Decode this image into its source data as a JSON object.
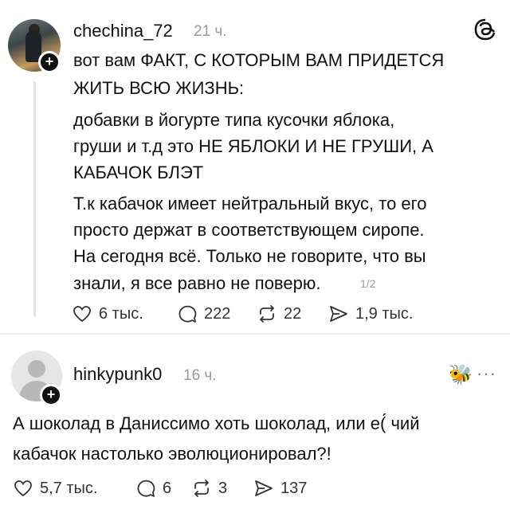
{
  "post1": {
    "username": "chechina_72",
    "time": "21 ч.",
    "lines": [
      "вот вам ФАКТ, С КОТОРЫМ ВАМ ПРИДЕТСЯ",
      "ЖИТЬ ВСЮ ЖИЗНЬ:",
      "добавки в йогурте типа кусочки яблока,",
      "груши и т.д это НЕ ЯБЛОКИ И НЕ ГРУШИ, А",
      "КАБАЧОК БЛЭТ",
      "Т.к кабачок имеет нейтральный вкус, то его",
      "просто держат в соответствующем сиропе.",
      "На сегодня всё. Только не говорите, что вы",
      "знали, я все равно не поверю."
    ],
    "pager": "1/2",
    "likes": "6 тыс.",
    "comments": "222",
    "reposts": "22",
    "shares": "1,9 тыс."
  },
  "post2": {
    "username": "hinkypunk0",
    "time": "16 ч.",
    "emoji": "🐝",
    "more": "···",
    "lines": [
      "А шоколад в Даниссимо хоть шоколад, или е(́ чий",
      "кабачок настолько эволюционировал?!"
    ],
    "likes": "5,7 тыс.",
    "comments": "6",
    "reposts": "3",
    "shares": "137"
  },
  "icons": {
    "app_logo": "threads-logo-icon",
    "follow": "plus-icon",
    "like": "heart-icon",
    "comment": "comment-icon",
    "repost": "repost-icon",
    "share": "send-icon"
  }
}
